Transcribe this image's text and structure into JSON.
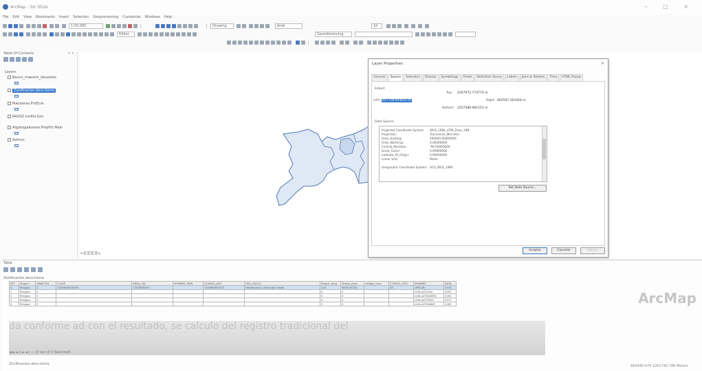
{
  "window": {
    "title": "ArcMap - Sin título",
    "controls": "– □ ×"
  },
  "menu": [
    "File",
    "Edit",
    "View",
    "Bookmarks",
    "Insert",
    "Selection",
    "Geoprocessing",
    "Customize",
    "Windows",
    "Help"
  ],
  "toolbar": {
    "scale": "1:50,000",
    "drawing_label": "Drawing",
    "font": "Arial",
    "font_size": "10",
    "georeferencing_label": "Georeferencing",
    "editor_label": "Editor"
  },
  "toc": {
    "title": "Table Of Contents",
    "close": "× ×",
    "root": "Layers",
    "layers": [
      {
        "name": "Banco_maestro_docentes",
        "checked": true,
        "selected": false
      },
      {
        "name": "Zonificacion.docs.tierra",
        "checked": true,
        "selected": true
      },
      {
        "name": "Manzanas.ProEcre",
        "checked": true,
        "selected": false
      },
      {
        "name": "RAUSZ.nmPol.Gon",
        "checked": false,
        "selected": false
      },
      {
        "name": "Algohogalezone.PropFol.Main",
        "checked": false,
        "selected": false
      },
      {
        "name": "Azimut",
        "checked": false,
        "selected": false
      }
    ]
  },
  "map": {
    "status": "◄ ▒ ▒ ▒ ▒ ►"
  },
  "dialog": {
    "title": "Layer Properties",
    "close": "×",
    "tabs": [
      "General",
      "Source",
      "Selection",
      "Display",
      "Symbology",
      "Fields",
      "Definition Query",
      "Labels",
      "Joins & Relates",
      "Time",
      "HTML Popup"
    ],
    "active_tab": "Source",
    "extent_label": "Extent",
    "top_label": "Top:",
    "top_value": "2267972.774774 m",
    "left_label": "Left:",
    "left_value": "657728.443631 m",
    "right_label": "Right:",
    "right_value": "662597.263429 m",
    "bottom_label": "Bottom:",
    "bottom_value": "2257288.981153 m",
    "data_source_label": "Data Source",
    "data_source": [
      {
        "k": "Projected Coordinate System:",
        "v": "WGS_1984_UTM_Zone_14N"
      },
      {
        "k": "Projection:",
        "v": "Transverse_Mercator"
      },
      {
        "k": "False_Easting:",
        "v": "500000.00000000"
      },
      {
        "k": "False_Northing:",
        "v": "0.00000000"
      },
      {
        "k": "Central_Meridian:",
        "v": "-99.00000000"
      },
      {
        "k": "Scale_Factor:",
        "v": "0.99960000"
      },
      {
        "k": "Latitude_Of_Origin:",
        "v": "0.00000000"
      },
      {
        "k": "Linear Unit:",
        "v": "Meter"
      },
      {
        "k": "",
        "v": ""
      },
      {
        "k": "Geographic Coordinate System:",
        "v": "GCS_WGS_1984"
      }
    ],
    "set_source_button": "Set Data Source...",
    "ok_button": "Aceptar",
    "cancel_button": "Cancelar",
    "apply_button": "Aplicar"
  },
  "table": {
    "title": "Table",
    "close": "□ ×",
    "layer_tab": "Zonificacion.docs.tierra",
    "columns": [
      "FID",
      "Shape *",
      "OBJECTID",
      "CLAVE",
      "AREA_CAL",
      "NOMBRE_MAN",
      "CODIGO_ANT",
      "USO_SUELO",
      "Shape_Leng",
      "Shape_Area",
      "codigo_nuev",
      "CODIGO_GEO",
      "NOMBRE",
      "DATA"
    ],
    "rows": [
      [
        "0",
        "Polygon",
        "1",
        "1509806050005",
        "1509806053",
        "",
        "150980605025",
        "Habitacional, densidad media",
        "125",
        "9876.54321",
        "",
        "25",
        "LPKCUB",
        "1574"
      ],
      [
        "1",
        "Polygon",
        "2",
        "",
        "",
        "",
        "",
        "",
        "0",
        "0",
        "",
        "",
        "LUXLAZOGUA",
        "2952"
      ],
      [
        "2",
        "Polygon",
        "3",
        "",
        "",
        "",
        "",
        "",
        "0",
        "0",
        "",
        "",
        "LUXLAZOVIADES",
        "3182"
      ],
      [
        "3",
        "Polygon",
        "4",
        "",
        "",
        "",
        "",
        "",
        "0",
        "0",
        "",
        "",
        "LUXLAZOTREO",
        "3137"
      ],
      [
        "4",
        "Polygon",
        "5",
        "",
        "",
        "",
        "",
        "",
        "0",
        "0",
        "",
        "",
        "LUXLAZOSABAT",
        "1282"
      ]
    ],
    "ghost_text": "da conforme ad con el resultado, se calculo del registro tradicional del",
    "nav": "◄◄  ◄  1  ►  ►|  ▭  (0 out of 5 Selected)",
    "bottom_tab": "Zonificacion.docs.tierra",
    "coords": "660440.474  2262740.786 Meters"
  },
  "watermark": "ArcMap",
  "colors": {
    "selection": "#3778c9",
    "polygon_fill": "#dfe8f5",
    "polygon_stroke": "#4e79b2"
  }
}
